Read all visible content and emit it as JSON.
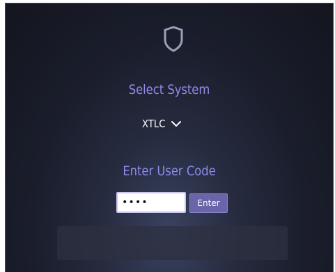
{
  "login": {
    "select_title": "Select System",
    "system_value": "XTLC",
    "code_title": "Enter User Code",
    "code_value": "1234",
    "enter_label": "Enter"
  },
  "colors": {
    "accent": "#8f8cf0",
    "button": "#6a64a9",
    "background": "#1a1d2b"
  },
  "icons": {
    "logo": "shield-icon",
    "dropdown": "chevron-down-icon"
  }
}
